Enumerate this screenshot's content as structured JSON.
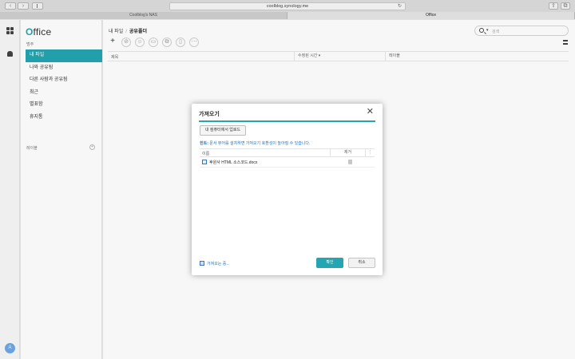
{
  "browser": {
    "url": "coolblog.synology.me",
    "tabs": [
      {
        "label": "Coolblog's NAS",
        "active": false
      },
      {
        "label": "Office",
        "active": true
      }
    ]
  },
  "rail": {
    "avatar_letter": "A"
  },
  "sidebar": {
    "logo_rest": "ffice",
    "logo_o": "O",
    "section_label": "범주",
    "items": [
      {
        "label": "내 파일",
        "active": true
      },
      {
        "label": "나와 공유됨",
        "active": false
      },
      {
        "label": "다른 사람과 공유됨",
        "active": false
      },
      {
        "label": "최근",
        "active": false
      },
      {
        "label": "별표함",
        "active": false
      },
      {
        "label": "휴지통",
        "active": false
      }
    ],
    "labels_header": "레이블"
  },
  "main": {
    "breadcrumb": [
      "내 파일",
      "공유폴더"
    ],
    "breadcrumb_sep": "/",
    "search_placeholder": "검색",
    "columns": [
      "제목",
      "수정된 시간 ▾",
      "레이블"
    ]
  },
  "dialog": {
    "title": "가져오기",
    "upload_label": "내 컴퓨터에서 업로드",
    "tip_prefix": "힌트:",
    "tip_text": "문서 뷰어를 설치하면 가져오기 호환성이 높아질 수 있습니다.",
    "file_columns": [
      "이름",
      "제거",
      "⋮"
    ],
    "files": [
      {
        "name": "후원사 HTML 소스코드.docx"
      }
    ],
    "more_link": "가져오는 중...",
    "ok_label": "확인",
    "cancel_label": "취소"
  },
  "colors": {
    "accent": "#23a6b1",
    "link": "#1e6fbf"
  }
}
